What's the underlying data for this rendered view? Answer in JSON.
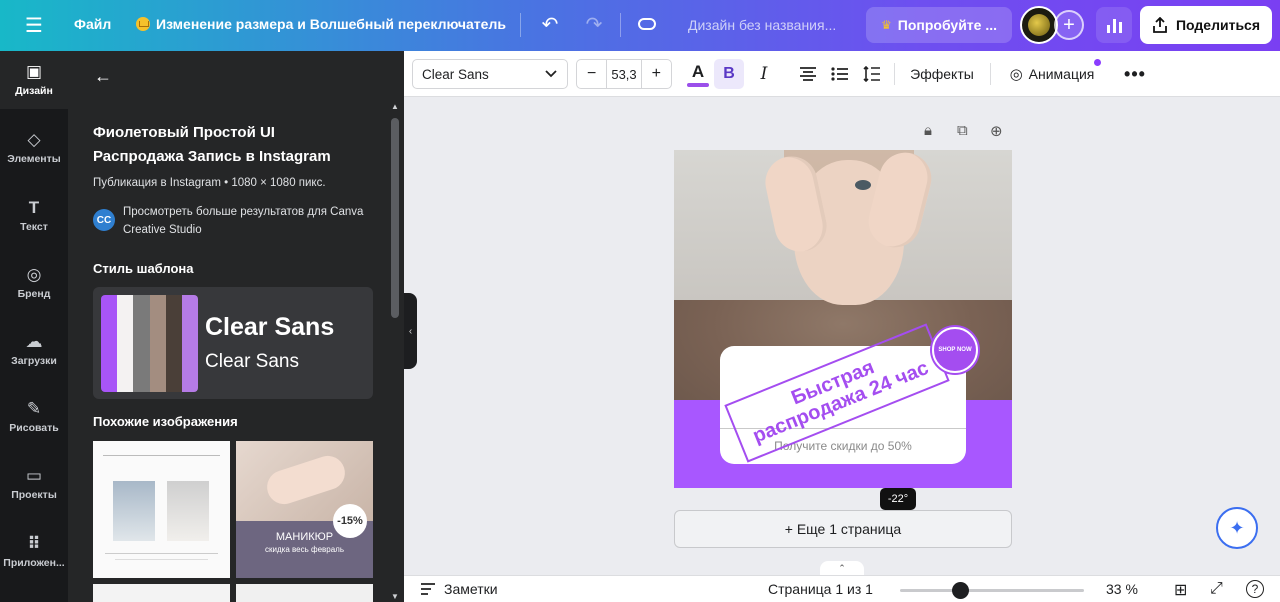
{
  "topbar": {
    "file_label": "Файл",
    "design_title": "Изменение размера и Волшебный переключатель",
    "doc_name": "Дизайн без названия...",
    "try_label": "Попробуйте ...",
    "share_label": "Поделиться"
  },
  "rail": {
    "items": [
      {
        "label": "Дизайн",
        "icon": "design-icon"
      },
      {
        "label": "Элементы",
        "icon": "elements-icon"
      },
      {
        "label": "Текст",
        "icon": "text-icon"
      },
      {
        "label": "Бренд",
        "icon": "brand-icon"
      },
      {
        "label": "Загрузки",
        "icon": "upload-icon"
      },
      {
        "label": "Рисовать",
        "icon": "draw-icon"
      },
      {
        "label": "Проекты",
        "icon": "folder-icon"
      },
      {
        "label": "Приложен...",
        "icon": "apps-icon"
      }
    ]
  },
  "panel": {
    "title": "Фиолетовый Простой UI Распродажа Запись в Instagram",
    "subtitle": "Публикация в Instagram • 1080 × 1080 пикс.",
    "creator_initials": "CC",
    "creator_link": "Просмотреть больше результатов для Canva Creative Studio",
    "style_heading": "Стиль шаблона",
    "font_primary": "Clear Sans",
    "font_secondary": "Clear Sans",
    "swatches": [
      "#a855f7",
      "#f4f2f2",
      "#7a7a7a",
      "#a38d80",
      "#4a3f38",
      "#b57be6"
    ],
    "similar_heading": "Похожие изображения",
    "thumb2_badge": "-15%",
    "thumb2_title": "МАНИКЮР",
    "thumb2_sub": "скидка весь февраль"
  },
  "toolbar": {
    "font_name": "Clear Sans",
    "font_size": "53,3",
    "color_letter": "A",
    "bold_letter": "B",
    "italic_letter": "I",
    "effects_label": "Эффекты",
    "animation_label": "Анимация"
  },
  "canvas": {
    "sticker_line1": "Быстрая",
    "sticker_line2": "распродажа 24 час",
    "seal_text": "SHOP NOW",
    "card_sub": "Получите скидки до 50%",
    "rotation": "-22°",
    "add_page": "+ Еще 1 страница"
  },
  "bottombar": {
    "notes_label": "Заметки",
    "page_info": "Страница 1 из 1",
    "zoom_fraction": 0.33,
    "zoom_label": "33 %"
  }
}
